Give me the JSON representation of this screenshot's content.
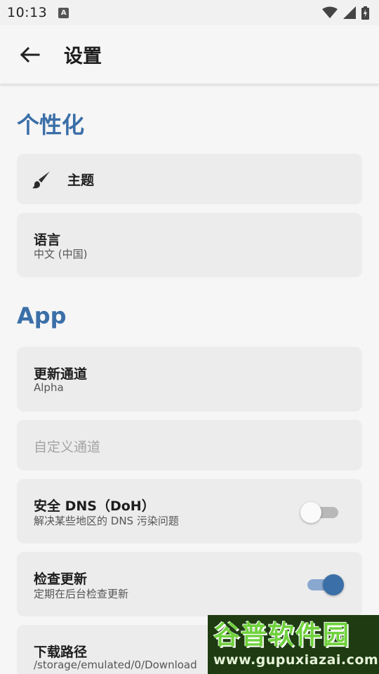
{
  "status_bar": {
    "time": "10:13",
    "notification_icon": "a-letter-icon",
    "icons": [
      "wifi-icon",
      "signal-icon",
      "battery-icon"
    ]
  },
  "app_bar": {
    "back_icon": "arrow-left-icon",
    "title": "设置"
  },
  "sections": {
    "personalization": {
      "title": "个性化",
      "theme": {
        "icon": "brush-icon",
        "title": "主题"
      },
      "language": {
        "title": "语言",
        "value": "中文 (中国)"
      }
    },
    "app": {
      "title": "App",
      "update_channel": {
        "title": "更新通道",
        "value": "Alpha"
      },
      "custom_channel": {
        "title": "自定义通道",
        "enabled": false
      },
      "secure_dns": {
        "title": "安全 DNS（DoH）",
        "subtitle": "解决某些地区的 DNS 污染问题",
        "checked": false
      },
      "check_updates": {
        "title": "检查更新",
        "subtitle": "定期在后台检查更新",
        "checked": true
      },
      "download_path": {
        "title": "下载路径",
        "value": "/storage/emulated/0/Download"
      }
    }
  },
  "watermark": {
    "name": "谷普软件园",
    "url": "www.gupuxiazai.com"
  },
  "colors": {
    "accent": "#3b6fa8",
    "card": "#ececec",
    "background": "#f6f6f6"
  }
}
